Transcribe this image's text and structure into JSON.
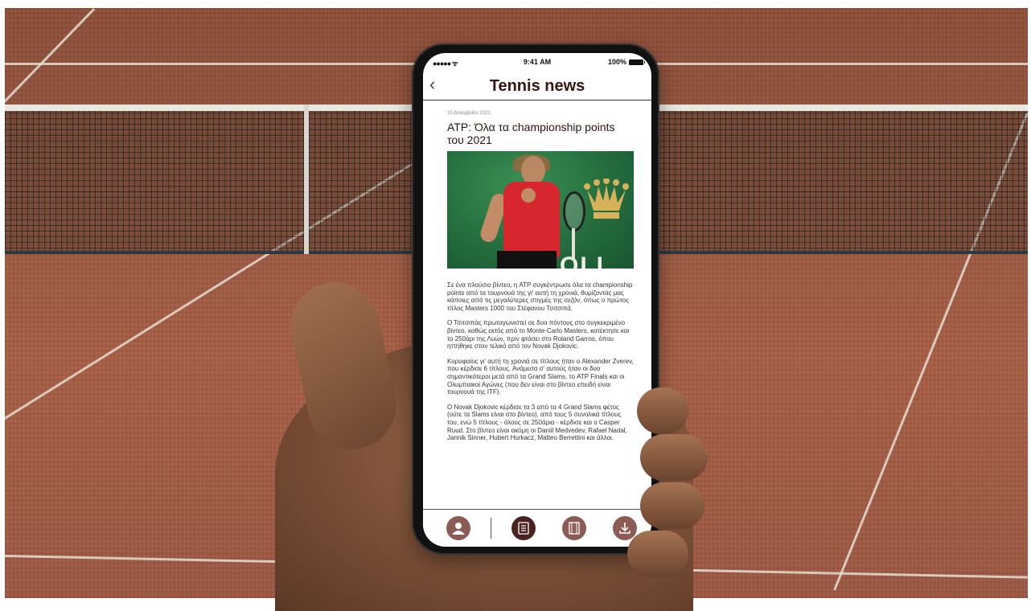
{
  "status_bar": {
    "signal": "●●●●● ᯤ",
    "time": "9:41 AM",
    "battery": "100%"
  },
  "nav": {
    "back": "‹",
    "title": "Tennis news"
  },
  "article": {
    "date": "15 Δεκεμβρίου 2021",
    "headline": "ATP: Όλα τα championship points του 2021",
    "photo_text": "OLI",
    "paragraphs": [
      "Σε ένα πλούσιο βίντεο, η ATP συγκέντρωσε όλα τα championship points από τα τουρνουά της γι' αυτή τη χρονιά, θυμίζοντάς μας κάποιες από τις μεγαλύτερες στιγμές της σεζόν, όπως ο πρώτος τίτλος Masters 1000 του Στέφανου Τσιτσιπά.",
      "Ο Τσιτσιπάς πρωταγωνιστεί σε δυο πόντους στο συγκεκριμένο βίντεο, καθώς εκτός από το Monte-Carlo Masters, κατέκτησε και το 250άρι της Λυών, πριν φτάσει στο Roland Garros, όπου ηττήθηκε στον τελικό από τον Novak Djokovic.",
      "Κορυφαίος γι' αυτή τη χρονιά σε τίτλους ήταν ο Alexander Zverev, που κέρδισε 6 τίτλους. Ανάμεσα σ' αυτούς ήταν οι δυο σημαντικότεροι μετά από τα Grand Slams, το ATP Finals και οι Ολυμπιακοί Αγώνες (που δεν είναι στο βίντεο επειδή είναι τουρνουά της ITF).",
      "Ο Novak Djokovic κέρδισε τα 3 από τα 4 Grand Slams φέτος (ούτε τα Slams είναι στο βίντεο), από τους 5 συνολικά τίτλους του, ενώ 5 τίτλους - όλους σε 250άρια - κέρδισε και ο Casper Ruud. Στο βίντεο είναι ακόμη οι Daniil Medvedev, Rafael Nadal, Jannik Sinner, Hubert Hurkacz, Matteo Berrettini και άλλοι."
    ]
  },
  "tab_bar": {
    "items": [
      {
        "icon": "profile-icon"
      },
      {
        "icon": "news-icon"
      },
      {
        "icon": "video-icon"
      },
      {
        "icon": "download-icon"
      }
    ]
  },
  "colors": {
    "accent": "#4a2320",
    "title": "#3a1410",
    "court": "#9a5840"
  }
}
